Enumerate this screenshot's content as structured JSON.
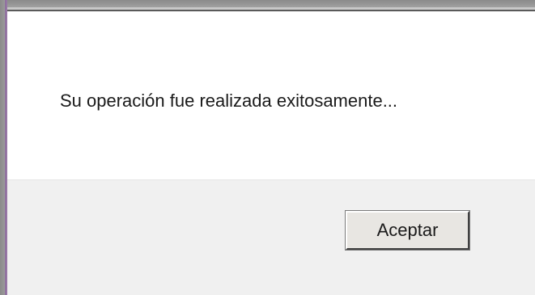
{
  "dialog": {
    "message": "Su operación fue realizada exitosamente...",
    "accept_label": "Aceptar"
  },
  "colors": {
    "content_background": "#ffffff",
    "button_area_background": "#f0f0f0",
    "button_face": "#e8e6e2",
    "frame_accent": "#9b7aa8"
  }
}
